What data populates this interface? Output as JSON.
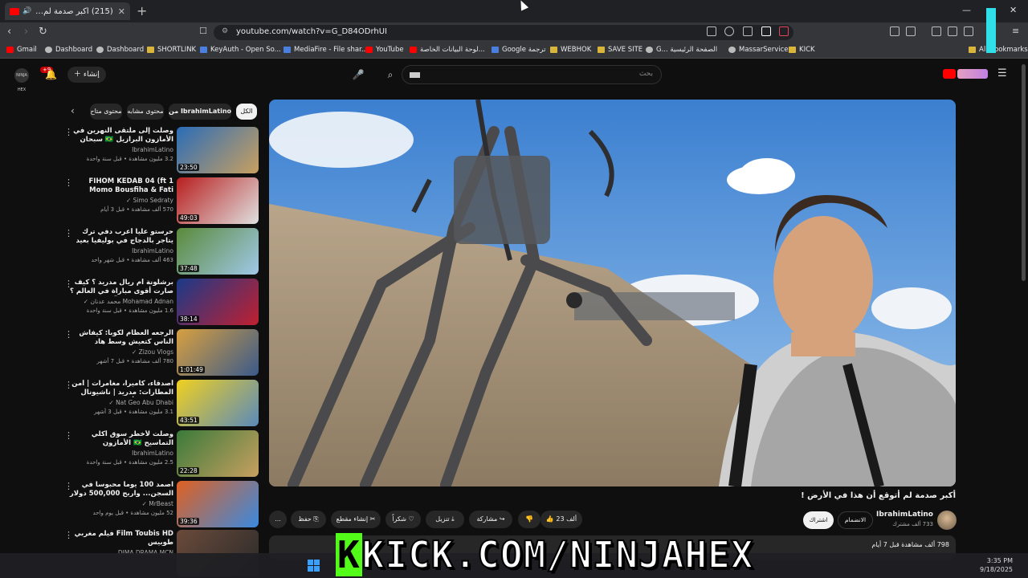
{
  "browser": {
    "tab_title": "(215) أكبر صدمة لم أتوقع أن...",
    "url": "youtube.com/watch?v=G_D84ODrhUI",
    "bookmarks": [
      {
        "label": "Gmail",
        "icon": "gmail-icon"
      },
      {
        "label": "Dashboard",
        "icon": "dashboard-icon"
      },
      {
        "label": "Dashboard",
        "icon": "dashboard-icon"
      },
      {
        "label": "SHORTLINK",
        "icon": "folder-icon"
      },
      {
        "label": "KeyAuth - Open So...",
        "icon": "keyauth-icon"
      },
      {
        "label": "MediaFire - File shar...",
        "icon": "mediafire-icon"
      },
      {
        "label": "YouTube",
        "icon": "youtube-icon"
      },
      {
        "label": "لوحة البيانات الخاصة...",
        "icon": "youtube-icon"
      },
      {
        "label": "Google ترجمة",
        "icon": "translate-icon"
      },
      {
        "label": "WEBHOK",
        "icon": "folder-icon"
      },
      {
        "label": "SAVE SITE",
        "icon": "folder-icon"
      },
      {
        "label": "G... الصفحة الرئيسية",
        "icon": "google-icon"
      },
      {
        "label": "MassarService",
        "icon": "globe-icon"
      },
      {
        "label": "KICK",
        "icon": "folder-icon"
      },
      {
        "label": "All Bookmarks",
        "icon": "folder-icon"
      }
    ]
  },
  "youtube": {
    "search_placeholder": "بحث",
    "create_label": "إنشاء",
    "notif_count": "+9",
    "avatar_text": "NINJA HEX",
    "chips": [
      {
        "label": "الكل",
        "active": true
      },
      {
        "label": "من IbrahimLatino",
        "active": false
      },
      {
        "label": "محتوى مشابه",
        "active": false
      },
      {
        "label": "محتوى متاح",
        "active": false
      }
    ],
    "related": [
      {
        "title": "وصلت إلى ملتقى النهرين في الأمازون البرازيل 🇧🇷 سبحان الله",
        "channel": "IbrahimLatino",
        "meta": "3.2 مليون مشاهدة • قبل سنة واحدة",
        "duration": "23:50",
        "colors": [
          "#2a6cb8",
          "#c9a060"
        ]
      },
      {
        "title": "1 FIHOM KEDAB 04 (ft Momo Bousfiha & Fati Jamali)",
        "channel": "Simo Sedraty ✓",
        "meta": "570 ألف مشاهدة • قبل 3 أيام",
        "duration": "49:03",
        "colors": [
          "#b81e1e",
          "#e0e0e0"
        ]
      },
      {
        "title": "حرستو عليا أعرب دفي ترك يتاجر بالدجاج في بوليفيا بعيد عن البحر 🇧🇴",
        "channel": "IbrahimLatino",
        "meta": "463 ألف مشاهدة • قبل شهر واحد",
        "duration": "37:48",
        "colors": [
          "#5a8a3a",
          "#a0c8e8"
        ]
      },
      {
        "title": "برشلونة أم ريال مدريد ؟ كيف صارت أقوى مباراة في العالم ؟ - القصة الكاملة ⚽",
        "channel": "Mohamad Adnan محمد عدنان ✓",
        "meta": "1.6 مليون مشاهدة • قبل سنة واحدة",
        "duration": "38:14",
        "colors": [
          "#1a3a8a",
          "#c02030"
        ]
      },
      {
        "title": "الرجعه العظام لكوبا: كيفاش الناس كتعيش وسط هاد الظروف؟",
        "channel": "Zizou Vlogs ✓",
        "meta": "780 ألف مشاهدة • قبل 7 أشهر",
        "duration": "1:01:49",
        "colors": [
          "#d8a040",
          "#3a5a8a"
        ]
      },
      {
        "title": "أصدقاء، كاميرا، مغامرات | أمن المطارات: مدريد | ناشيونال جيوغرافيك أبوظبي",
        "channel": "Nat Geo Abu Dhabi ✓",
        "meta": "3.1 مليون مشاهدة • قبل 3 أشهر",
        "duration": "43:51",
        "colors": [
          "#f0d020",
          "#5a8aba"
        ]
      },
      {
        "title": "وصلت لأخطر سوق أكلي التماسيح 🇧🇷 الأمازون",
        "channel": "IbrahimLatino",
        "meta": "2.5 مليون مشاهدة • قبل سنة واحدة",
        "duration": "22:28",
        "colors": [
          "#3a7a3a",
          "#c8a060"
        ]
      },
      {
        "title": "اصمد 100 يوماً محبوساً في السجن... واربح 500,000 دولار",
        "channel": "MrBeast ✓",
        "meta": "52 مليون مشاهدة • قبل يوم واحد",
        "duration": "39:36",
        "colors": [
          "#e06020",
          "#3a8ae0"
        ]
      },
      {
        "title": "Film Toubis HD فيلم مغربي طوبيس",
        "channel": "DIMA DRAMA MCN",
        "meta": "",
        "duration": "",
        "colors": [
          "#6a4a3a",
          "#2a2a2a"
        ]
      }
    ],
    "video": {
      "title": "أكبر صدمة لم أتوقع أن هذا في الأرض !",
      "channel": "IbrahimLatino",
      "subs": "733 ألف مشترك",
      "subscribe_label": "اشتراك",
      "join_label": "الانضمام",
      "likes": "23 ألف",
      "share_label": "مشاركة",
      "download_label": "تنزيل",
      "thanks_label": "شكراً",
      "clip_label": "إنشاء مقطع",
      "save_label": "حفظ",
      "more_label": "...",
      "views_meta": "798 ألف مشاهدة  قبل 7 أيام"
    }
  },
  "overlay": {
    "kick_k": "K",
    "kick_text": "KICK.COM/NINJAHEX"
  },
  "taskbar": {
    "time": "3:35 PM",
    "date": "9/18/2025"
  }
}
